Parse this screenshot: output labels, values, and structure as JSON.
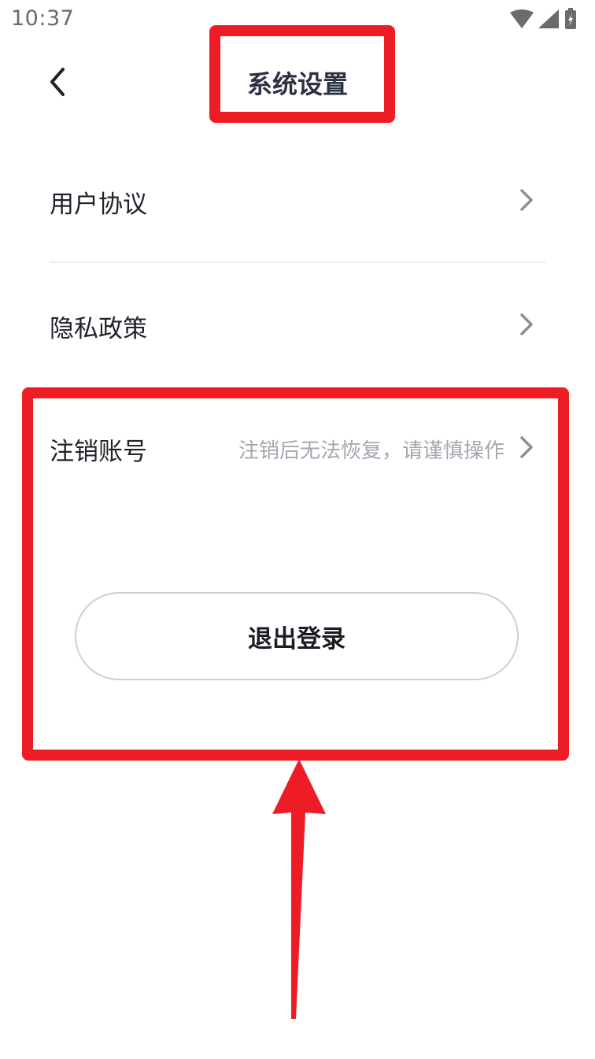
{
  "status_bar": {
    "time": "10:37",
    "icons": [
      "wifi-icon",
      "signal-icon",
      "battery-charging-icon"
    ]
  },
  "nav": {
    "back_icon": "chevron-left-icon",
    "title": "系统设置"
  },
  "settings": {
    "items": [
      {
        "label": "用户协议",
        "hint": "",
        "icon": "chevron-right-icon"
      },
      {
        "label": "隐私政策",
        "hint": "",
        "icon": "chevron-right-icon"
      },
      {
        "label": "注销账号",
        "hint": "注销后无法恢复，请谨慎操作",
        "icon": "chevron-right-icon"
      }
    ]
  },
  "logout": {
    "label": "退出登录"
  },
  "colors": {
    "annotation": "#ee1d25",
    "text_primary": "#1f2329",
    "text_secondary": "#a3a8b0",
    "divider": "#ebedf0",
    "button_border": "#c9d0db"
  }
}
